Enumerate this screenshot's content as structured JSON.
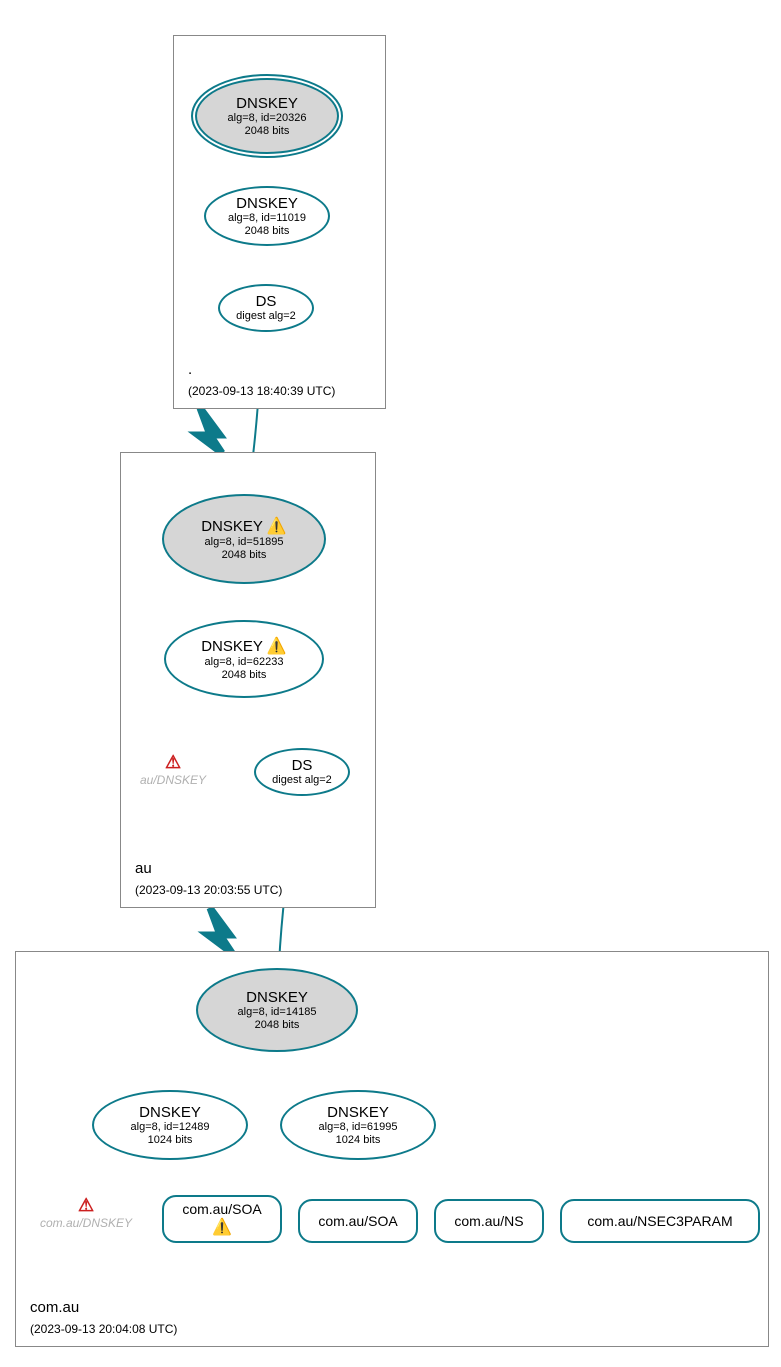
{
  "zones": {
    "root": {
      "label": ".",
      "timestamp": "(2023-09-13 18:40:39 UTC)",
      "dnskey_ksk": {
        "title": "DNSKEY",
        "line1": "alg=8, id=20326",
        "line2": "2048 bits"
      },
      "dnskey_zsk": {
        "title": "DNSKEY",
        "line1": "alg=8, id=11019",
        "line2": "2048 bits"
      },
      "ds": {
        "title": "DS",
        "line1": "digest alg=2"
      }
    },
    "au": {
      "label": "au",
      "timestamp": "(2023-09-13 20:03:55 UTC)",
      "dnskey_ksk": {
        "title": "DNSKEY",
        "line1": "alg=8, id=51895",
        "line2": "2048 bits"
      },
      "dnskey_zsk": {
        "title": "DNSKEY",
        "line1": "alg=8, id=62233",
        "line2": "2048 bits"
      },
      "ds": {
        "title": "DS",
        "line1": "digest alg=2"
      },
      "annot": "au/DNSKEY"
    },
    "comau": {
      "label": "com.au",
      "timestamp": "(2023-09-13 20:04:08 UTC)",
      "dnskey_ksk": {
        "title": "DNSKEY",
        "line1": "alg=8, id=14185",
        "line2": "2048 bits"
      },
      "dnskey_zsk1": {
        "title": "DNSKEY",
        "line1": "alg=8, id=12489",
        "line2": "1024 bits"
      },
      "dnskey_zsk2": {
        "title": "DNSKEY",
        "line1": "alg=8, id=61995",
        "line2": "1024 bits"
      },
      "annot": "com.au/DNSKEY",
      "leaf_soa_warn": "com.au/SOA",
      "leaf_soa": "com.au/SOA",
      "leaf_ns": "com.au/NS",
      "leaf_nsec3": "com.au/NSEC3PARAM"
    }
  },
  "icons": {
    "warn_yellow": "⚠️",
    "warn_outline": "⚠"
  }
}
